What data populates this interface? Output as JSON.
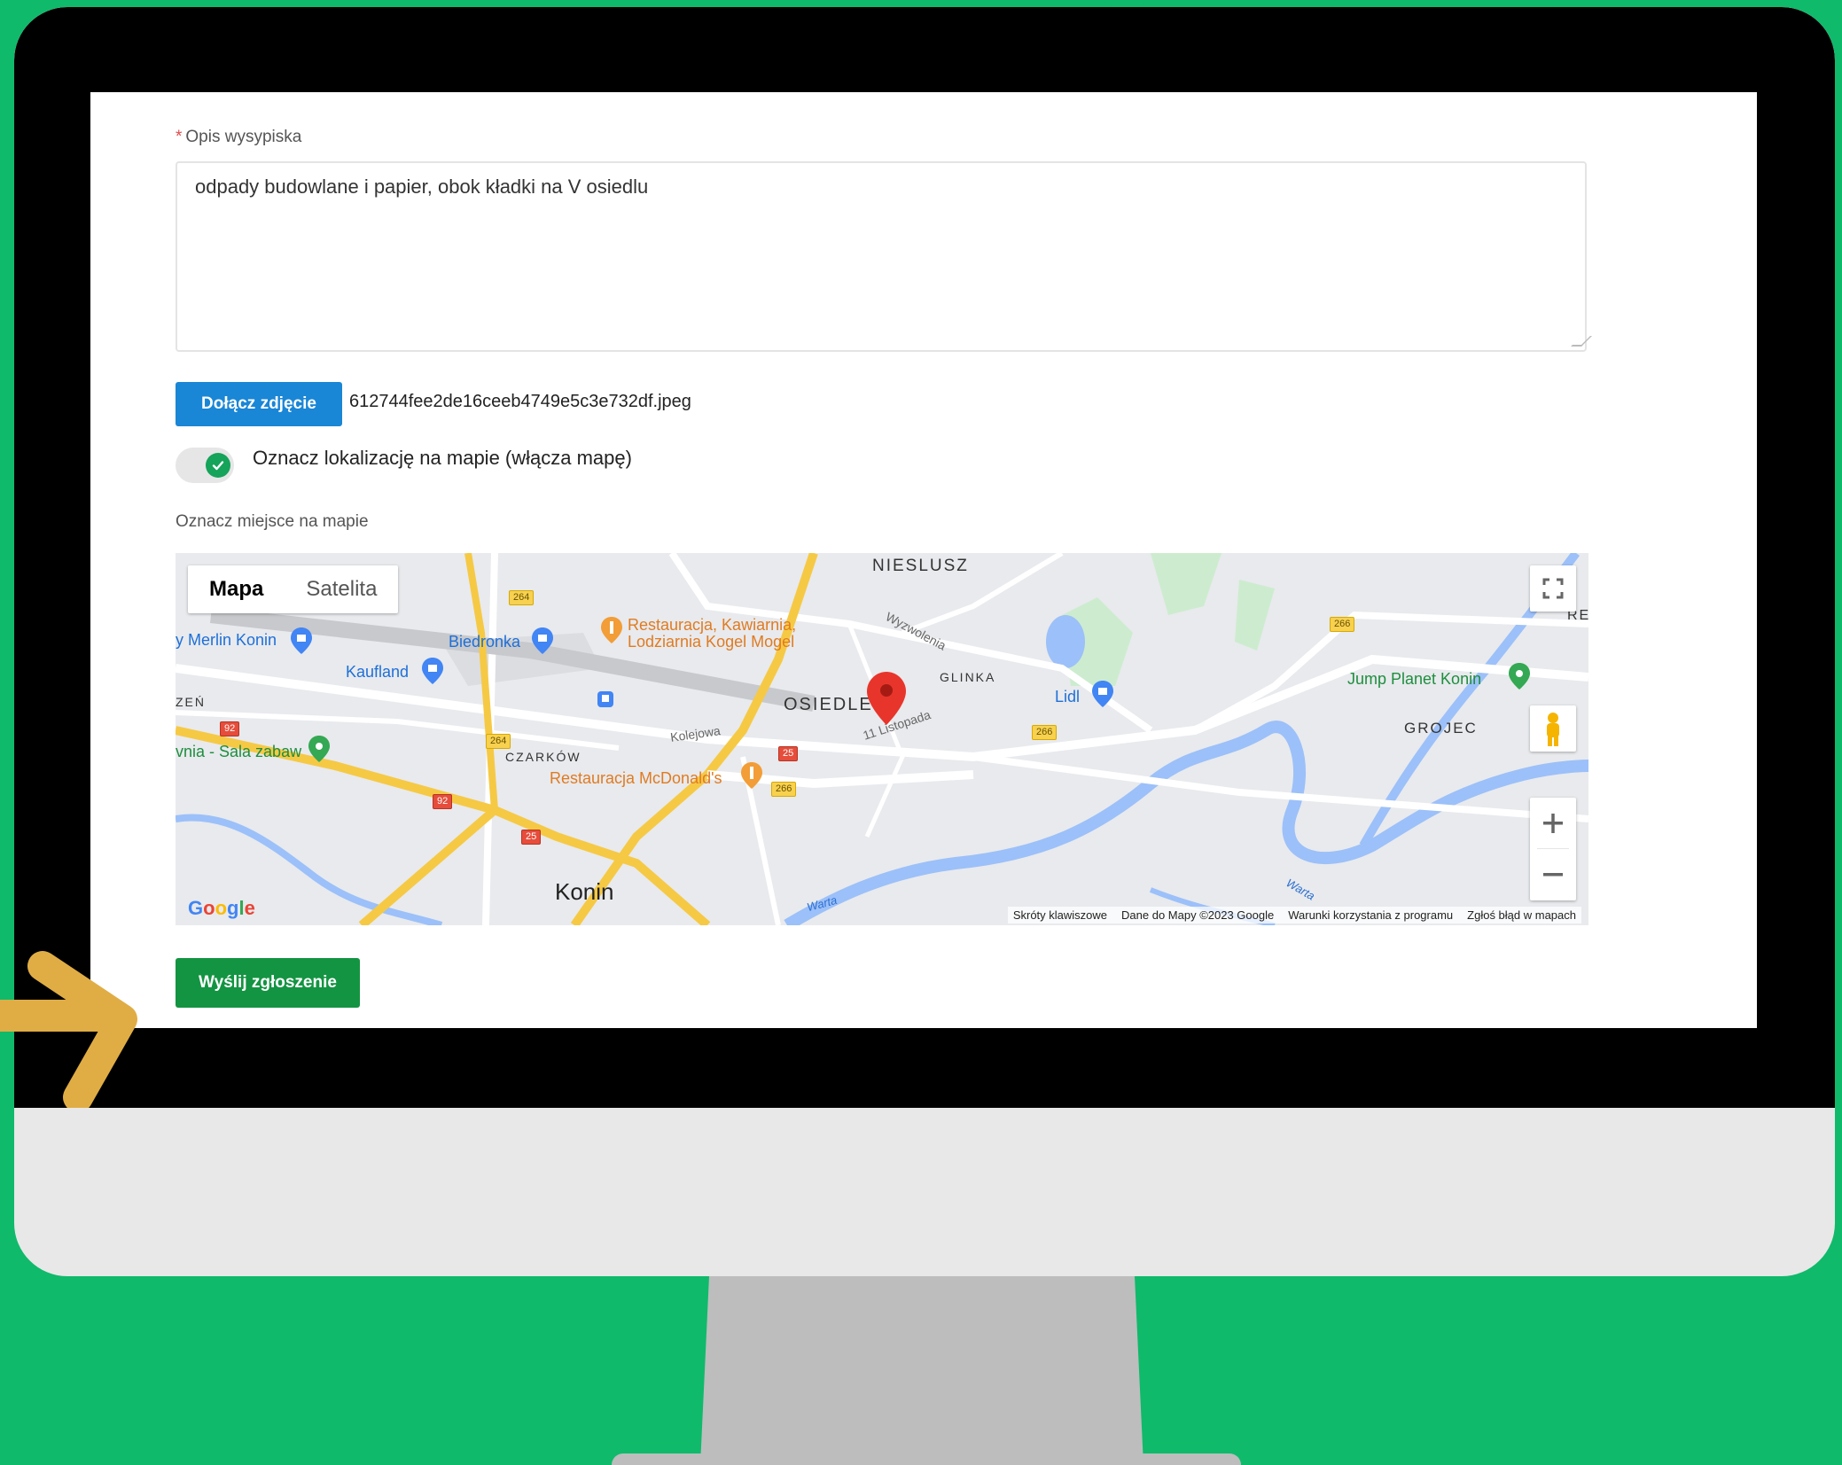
{
  "form": {
    "description_label": "Opis wysypiska",
    "description_value": "odpady budowlane i papier, obok kładki na V osiedlu",
    "attach_button": "Dołącz zdjęcie",
    "attached_file": "612744fee2de16ceeb4749e5c3e732df.jpeg",
    "location_toggle_label": "Oznacz lokalizację na mapie (włącza mapę)",
    "location_toggle_on": true,
    "map_label": "Oznacz miejsce na mapie",
    "submit_button": "Wyślij zgłoszenie"
  },
  "map": {
    "type_buttons": [
      "Mapa",
      "Satelita"
    ],
    "active_type": "Mapa",
    "places": {
      "niesłusz": "NIESLUSZ",
      "glinka": "GLINKA",
      "osiedle_v": "OSIEDLE V",
      "grojec": "GROJEC",
      "czarkow": "CZARKÓW",
      "konin": "Konin",
      "zen": "ZEŃ",
      "rei": "REI"
    },
    "pois": {
      "merlin": "y Merlin Konin",
      "biedronka": "Biedronka",
      "kaufland": "Kaufland",
      "restauracja_kogel_1": "Restauracja, Kawiarnia,",
      "restauracja_kogel_2": "Lodziarnia Kogel Mogel",
      "mcdonalds": "Restauracja McDonald's",
      "lidl": "Lidl",
      "jump_planet": "Jump Planet Konin",
      "sala_zabaw": "vnia - Sala zabaw"
    },
    "streets": {
      "kolejowa": "Kolejowa",
      "listopada": "11 Listopada",
      "wyzwolenia": "Wyzwolenia",
      "warta_1": "Warta",
      "warta_2": "Warta"
    },
    "road_numbers": {
      "r264a": "264",
      "r264b": "264",
      "r266a": "266",
      "r266b": "266",
      "r266c": "266",
      "r25a": "25",
      "r25b": "25",
      "r92a": "92",
      "r92b": "92"
    },
    "footer": [
      "Skróty klawiszowe",
      "Dane do Mapy ©2023 Google",
      "Warunki korzystania z programu",
      "Zgłoś błąd w mapach"
    ],
    "logo_letters": [
      "G",
      "o",
      "o",
      "g",
      "l",
      "e"
    ]
  },
  "colors": {
    "background": "#0fba6b",
    "attach_button": "#1a86d6",
    "submit_button": "#139442",
    "arrow": "#e0ad45",
    "pin": "#e8352b"
  }
}
